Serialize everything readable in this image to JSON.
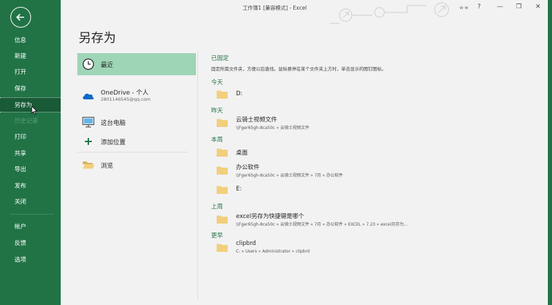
{
  "window": {
    "title": "工作簿1 [兼容模式] - Excel",
    "user": "w w",
    "help": "?",
    "minimize": "—",
    "restore": "❐",
    "close": "✕"
  },
  "nav": {
    "back_icon": "back-arrow-icon",
    "items": [
      {
        "label": "信息"
      },
      {
        "label": "新建"
      },
      {
        "label": "打开"
      },
      {
        "label": "保存"
      },
      {
        "label": "另存为"
      },
      {
        "label": "历史记录"
      },
      {
        "label": "打印"
      },
      {
        "label": "共享"
      },
      {
        "label": "导出"
      },
      {
        "label": "发布"
      },
      {
        "label": "关闭"
      },
      {
        "label": "帐户"
      },
      {
        "label": "反馈"
      },
      {
        "label": "选项"
      }
    ]
  },
  "page_title": "另存为",
  "locations": {
    "recent": {
      "label": "最近",
      "icon": "clock-icon"
    },
    "onedrive": {
      "label": "OneDrive - 个人",
      "email": "2801146545@qq.com",
      "icon": "cloud-icon"
    },
    "this_pc": {
      "label": "这台电脑",
      "icon": "computer-icon"
    },
    "add_place": {
      "label": "添加位置",
      "icon": "plus-icon"
    },
    "browse": {
      "label": "浏览",
      "icon": "folder-open-icon"
    }
  },
  "folders": {
    "pinned": {
      "heading": "已固定",
      "description": "固定所需文件夹，方便以后查找。鼠标悬停在某个文件夹上方时，单击显示的图钉图标。"
    },
    "groups": [
      {
        "heading": "今天",
        "items": [
          {
            "name": "D:",
            "path": ""
          }
        ]
      },
      {
        "heading": "昨天",
        "items": [
          {
            "name": "云骑士视频文件",
            "path": "\\\\Fger65gh-8ca50c » 云骑士视频文件"
          }
        ]
      },
      {
        "heading": "本周",
        "items": [
          {
            "name": "桌面",
            "path": ""
          },
          {
            "name": "办公软件",
            "path": "\\\\Fger65gh-8ca50c » 云骑士视频文件 » 7月 » 办公软件"
          },
          {
            "name": "E:",
            "path": ""
          }
        ]
      },
      {
        "heading": "上周",
        "items": [
          {
            "name": "excel另存为快捷键是哪个",
            "path": "\\\\Fger65gh-8ca50c » 云骑士视频文件 » 7月 » 办公软件 » EXCEL » 7.23 » excel另存为..."
          }
        ]
      },
      {
        "heading": "更早",
        "items": [
          {
            "name": "clipbrd",
            "path": "C: » Users » Administrator » clipbrd"
          }
        ]
      }
    ]
  }
}
